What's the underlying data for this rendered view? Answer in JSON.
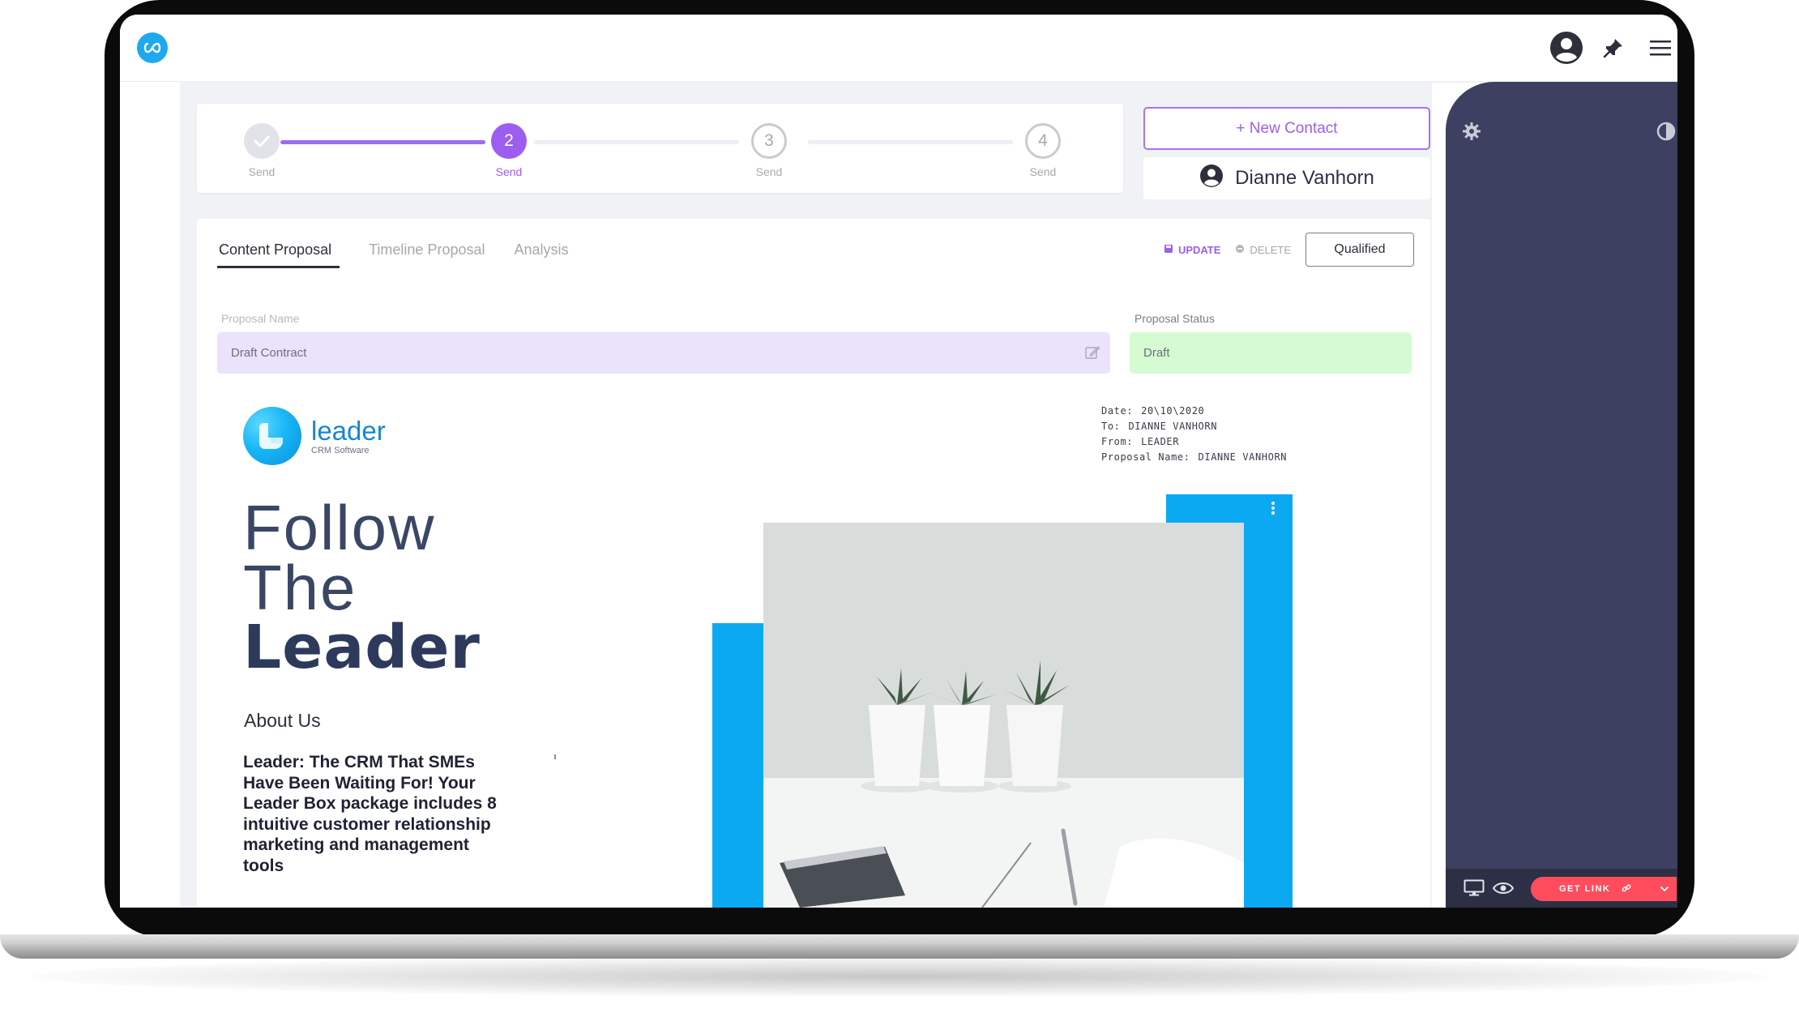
{
  "steps": [
    {
      "label": "Send",
      "number": "",
      "state": "done"
    },
    {
      "label": "Send",
      "number": "2",
      "state": "current"
    },
    {
      "label": "Send",
      "number": "3",
      "state": "todo"
    },
    {
      "label": "Send",
      "number": "4",
      "state": "todo"
    }
  ],
  "contact": {
    "new_contact_label": "+ New Contact",
    "name": "Dianne Vanhorn"
  },
  "tabs": [
    {
      "label": "Content Proposal",
      "active": true
    },
    {
      "label": "Timeline Proposal",
      "active": false
    },
    {
      "label": "Analysis",
      "active": false
    }
  ],
  "actions": {
    "update_label": "UPDATE",
    "delete_label": "DELETE",
    "status_button": "Qualified"
  },
  "fields": {
    "name_label": "Proposal Name",
    "name_value": "Draft Contract",
    "status_label": "Proposal Status",
    "status_value": "Draft"
  },
  "document": {
    "logo_text": "leader",
    "logo_sub": "CRM Software",
    "meta": [
      {
        "key": "Date:",
        "value": "20\\10\\2020"
      },
      {
        "key": "To:",
        "value": "DIANNE VANHORN"
      },
      {
        "key": "From:",
        "value": "LEADER"
      },
      {
        "key": "Proposal Name:",
        "value": "DIANNE VANHORN"
      }
    ],
    "headline_line1": "Follow",
    "headline_line2": "The",
    "headline_line3": "Leader",
    "about_title": "About Us",
    "about_text": "Leader: The CRM That SMEs Have Been Waiting For! Your Leader Box package includes 8 intuitive customer relationship marketing and management tools"
  },
  "panel": {
    "get_link_label": "GET LINK"
  },
  "colors": {
    "accent_purple": "#9b5ef0",
    "brand_blue": "#0ba9f2",
    "panel_dark": "#3d4061",
    "get_link_red": "#ff4d5e",
    "status_green_bg": "#d6fbd2",
    "name_field_bg": "#ebe2fb"
  },
  "icons": {
    "app_logo": "infinity-logo-icon",
    "user": "user-circle-icon",
    "pin": "pin-icon",
    "menu": "hamburger-menu-icon",
    "settings": "gear-icon",
    "theme": "contrast-icon",
    "desktop": "monitor-icon",
    "preview": "eye-icon",
    "link": "link-icon",
    "dropdown": "chevron-down-icon",
    "more": "vertical-dots-icon",
    "edit": "edit-icon",
    "save": "save-icon",
    "delete": "minus-circle-icon"
  }
}
